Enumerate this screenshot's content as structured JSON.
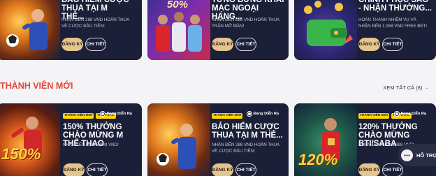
{
  "top_cards": [
    {
      "title": "BẢO HIỂM CƯỢC THUA TẠI M THẺ...",
      "description": "NHẬN ĐẾN 288 VND HOÀN THUA VỀ CƯỢC ĐẦU TIÊN!",
      "register": "ĐĂNG KÝ",
      "details": "CHI TIẾT"
    },
    {
      "title": "TƯNG BỪNG KHAI MẠC NGOẠI HẠNG...",
      "description": "NHẬN ĐẾN 888 VND HOÀN THUA TRẬN MỞ MÀN!",
      "register": "ĐĂNG KÝ",
      "details": "CHI TIẾT",
      "art_badge": "50%"
    },
    {
      "title": "CHÍNH PHỤC SAO - NHẬN THƯỞNG...",
      "description": "HOÀN THÀNH NHIỆM VỤ VÀ NHẬN ĐẾN 1,088 VND FREE BET!",
      "register": "ĐĂNG KÝ",
      "details": "CHI TIẾT"
    }
  ],
  "section": {
    "title": "THÀNH VIÊN MỚI",
    "see_all": "XEM TẤT CẢ (8)",
    "arrow": "→"
  },
  "bottom_cards": [
    {
      "tag_member": "THÀNH VIÊN MỚI",
      "tag_sport": "THỂ THAO",
      "status": "Đang Diễn Ra",
      "title": "150% THƯỞNG CHÀO MỪNG M THỂ THAO",
      "description": "NHẬN LÊN ĐẾN 5,888 VND!",
      "register": "ĐĂNG KÝ",
      "details": "CHI TIẾT",
      "art_badge": "150%"
    },
    {
      "tag_member": "THÀNH VIÊN MỚI",
      "status": "Đang Diễn Ra",
      "title": "BẢO HIỂM CƯỢC THUA TẠI M THẺ...",
      "description": "NHẬN ĐẾN 288 VND HOÀN THUA VỀ CƯỢC ĐẦU TIÊN!",
      "register": "ĐĂNG KÝ",
      "details": "CHI TIẾT"
    },
    {
      "tag_member": "THÀNH VIÊN MỚI",
      "tag_sport": "THỂ THAO",
      "status": "Đang Diễn Ra",
      "title": "120% THƯỞNG CHÀO MỪNG BTI/SABA",
      "description": "NHẬN LÊN ĐẾN 6,888 VND!",
      "register": "ĐĂNG KÝ",
      "details": "CHI TIẾT",
      "art_badge": "120%"
    }
  ],
  "chat": {
    "label": "HỖ TRỢ"
  },
  "colors": {
    "card_bg": "#1b1f38",
    "accent_red": "#e2463c",
    "gold_button": "#e6c48d",
    "tag_yellow": "#ffd400"
  }
}
